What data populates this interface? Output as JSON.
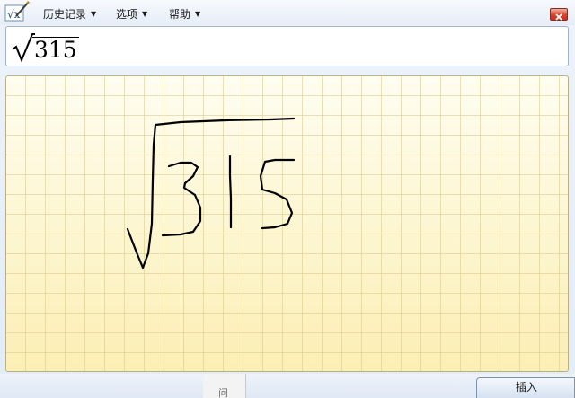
{
  "menu": {
    "items": [
      {
        "label": "历史记录",
        "caret": "▼"
      },
      {
        "label": "选项",
        "caret": "▼"
      },
      {
        "label": "帮助",
        "caret": "▼"
      }
    ]
  },
  "icons": {
    "app": "math-input-pen-icon",
    "close": "close-icon",
    "radical": "square-root-icon"
  },
  "preview": {
    "radicand": "315"
  },
  "background": {
    "partial_char": "问"
  },
  "buttons": {
    "insert_label": "插入"
  },
  "colors": {
    "pad": "#fdf6c4",
    "grid": "#d6c88c",
    "ink": "#000000",
    "close": "#d6432e",
    "frame": "#e3ebf6"
  }
}
